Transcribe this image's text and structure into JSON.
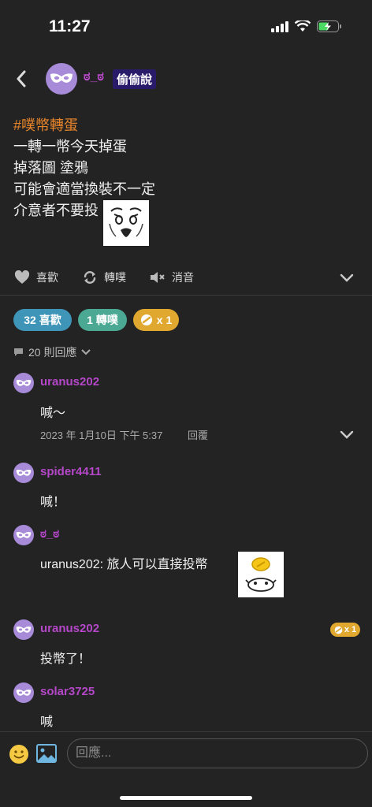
{
  "status": {
    "time": "11:27"
  },
  "post": {
    "author": "ಠ_ಠ",
    "board": "偷偷說",
    "tag": "#噗幣轉蛋",
    "lines": [
      "一轉一幣今天掉蛋",
      "掉落圖 塗鴉",
      "可能會適當換裝不一定",
      "介意者不要投"
    ]
  },
  "actions": {
    "like": "喜歡",
    "replurk": "轉噗",
    "mute": "消音"
  },
  "pills": {
    "likes": "32 喜歡",
    "replurks": "1 轉噗",
    "coins": "x 1"
  },
  "reply_count": "20 則回應",
  "comments": [
    {
      "name": "uranus202",
      "text": "喊～",
      "date": "2023 年 1月10日 下午 5:37",
      "reply": "回覆"
    },
    {
      "name": "spider4411",
      "text": "喊！"
    },
    {
      "name": "ಠ_ಠ",
      "text": "uranus202: 旅人可以直接投幣"
    },
    {
      "name": "uranus202",
      "text": "投幣了！",
      "coin": "x 1"
    },
    {
      "name": "solar3725",
      "text": "喊"
    }
  ],
  "input": {
    "placeholder": "回應..."
  },
  "colors": {
    "background": "#232323",
    "accent_purple": "#b547c9",
    "tag_orange": "#e8852a",
    "likes_pill": "#3f95b8",
    "replurk_pill": "#4aa893",
    "coin_pill": "#e0a82e"
  }
}
